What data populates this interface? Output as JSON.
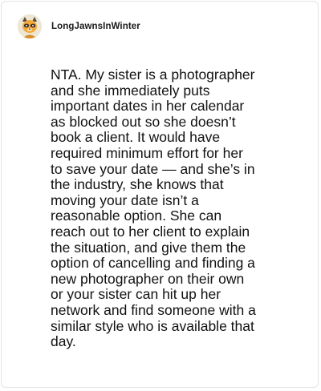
{
  "comment": {
    "author": {
      "username": "LongJawnsInWinter",
      "avatar_icon": "raccoon-avatar-icon"
    },
    "body": "NTA. My sister is a photographer\nand she immediately puts\nimportant dates in her calendar\nas blocked out so she doesn’t\nbook a client. It would have\nrequired minimum effort for her\nto save your date — and she’s in\nthe industry, she knows that\nmoving your date isn’t a\nreasonable option. She can\nreach out to her client to explain\nthe situation, and give them the\noption of cancelling and finding a\nnew photographer on their own\nor your sister can hit up her\nnetwork and find someone with a\nsimilar style who is available that\nday."
  },
  "colors": {
    "background": "#ffffff",
    "border": "#e3e3e3",
    "text": "#111111"
  }
}
